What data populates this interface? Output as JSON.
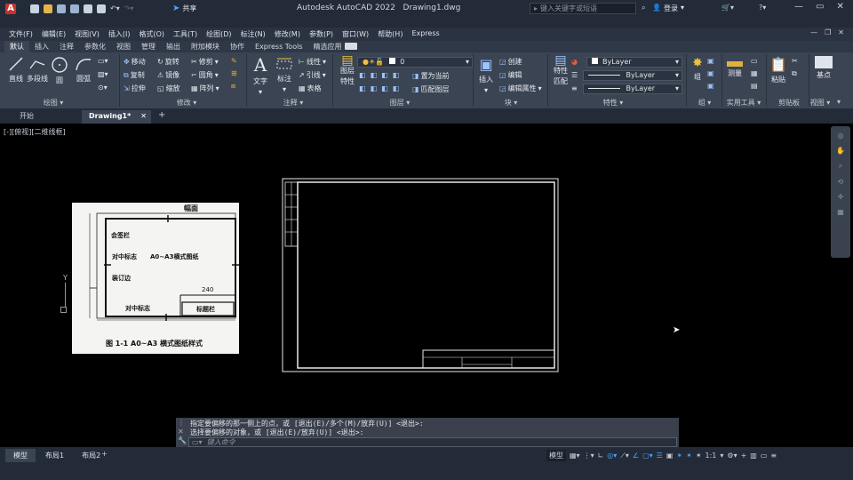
{
  "title": {
    "app_title": "Autodesk AutoCAD 2022",
    "file_name": "Drawing1.dwg",
    "search_placeholder": "键入关键字或短语",
    "login": "登录",
    "share": "共享"
  },
  "menu": [
    "文件(F)",
    "编辑(E)",
    "视图(V)",
    "插入(I)",
    "格式(O)",
    "工具(T)",
    "绘图(D)",
    "标注(N)",
    "修改(M)",
    "参数(P)",
    "窗口(W)",
    "帮助(H)",
    "Express"
  ],
  "ribbon_tabs": [
    "默认",
    "插入",
    "注释",
    "参数化",
    "视图",
    "管理",
    "输出",
    "附加模块",
    "协作",
    "Express Tools",
    "精选应用"
  ],
  "ribbon": {
    "draw": {
      "line": "直线",
      "polyline": "多段线",
      "circle": "圆",
      "arc": "圆弧",
      "title": "绘图"
    },
    "modify": {
      "move": "移动",
      "rotate": "旋转",
      "trim": "修剪",
      "copy": "复制",
      "mirror": "镜像",
      "fillet": "圆角",
      "stretch": "拉伸",
      "scale": "缩放",
      "array": "阵列",
      "title": "修改"
    },
    "annotation": {
      "text": "文字",
      "dimension": "标注",
      "linear": "线性",
      "leader": "引线",
      "table": "表格",
      "title": "注释"
    },
    "layers": {
      "layer_props": "图层",
      "layer_props2": "特性",
      "layer_value": "0",
      "set_current": "置为当前",
      "match_layer": "匹配图层",
      "title": "图层"
    },
    "block": {
      "insert": "插入",
      "create": "创建",
      "edit": "编辑",
      "edit_attr": "编辑属性",
      "title": "块"
    },
    "properties": {
      "match1": "特性",
      "match2": "匹配",
      "color": "ByLayer",
      "linetype": "ByLayer",
      "lineweight": "ByLayer",
      "title": "特性"
    },
    "groups": {
      "group": "组",
      "title": "组"
    },
    "utilities": {
      "measure": "测量",
      "title": "实用工具"
    },
    "clipboard": {
      "paste": "粘贴",
      "title": "剪贴板"
    },
    "view": {
      "base": "基点",
      "title": "视图"
    }
  },
  "doc_tabs": {
    "start": "开始",
    "drawing": "Drawing1*"
  },
  "viewport_label": "[-][俯视][二维线框]",
  "reference_image": {
    "label_top": "幅面",
    "countersign": "会签栏",
    "center_mark1": "对中标志",
    "format_name": "A0~A3横式图纸",
    "binding": "装订边",
    "dim_240": "240",
    "center_mark2": "对中标志",
    "title_block": "标题栏",
    "caption": "图 1-1   A0~A3 横式图纸样式"
  },
  "ucs": {
    "y": "Y"
  },
  "command": {
    "line1": "指定要偏移的那一侧上的点，或 [退出(E)/多个(M)/放弃(U)] <退出>:",
    "line2": "选择要偏移的对象，或 [退出(E)/放弃(U)] <退出>:",
    "placeholder": "键入命令"
  },
  "layout_tabs": [
    "模型",
    "布局1",
    "布局2"
  ],
  "status": {
    "model": "模型",
    "scale": "1:1"
  }
}
